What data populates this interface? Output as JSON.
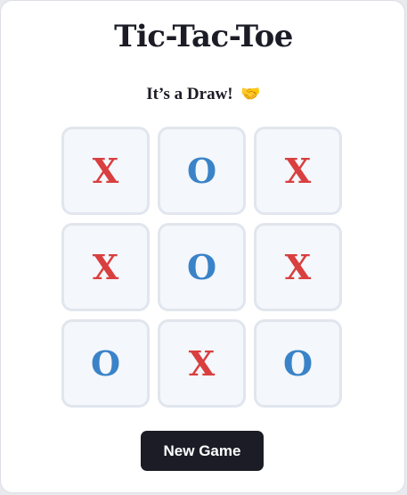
{
  "game": {
    "title": "Tic-Tac-Toe",
    "status": "It’s a Draw!",
    "status_emoji": "🤝",
    "board": [
      "X",
      "O",
      "X",
      "X",
      "O",
      "X",
      "O",
      "X",
      "O"
    ],
    "colors": {
      "X": "#d93f3f",
      "O": "#3a83c8"
    },
    "new_game_label": "New Game"
  }
}
